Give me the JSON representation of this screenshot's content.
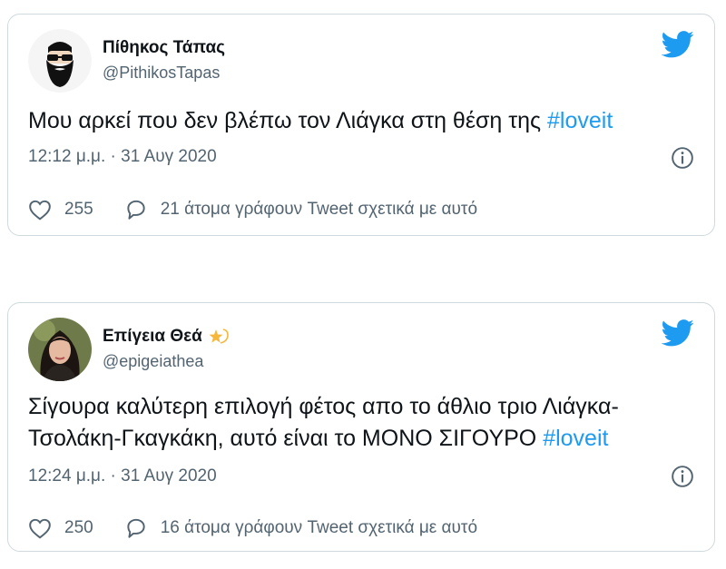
{
  "tweets": [
    {
      "display_name": "Πίθηκος Τάπας",
      "handle": "@PithikosTapas",
      "text": "Μου αρκεί που δεν βλέπω τον Λιάγκα στη θέση της ",
      "hashtag": "#loveit",
      "time": "12:12 μ.μ.",
      "separator": " · ",
      "date": "31 Αυγ 2020",
      "likes": "255",
      "replies": "21 άτομα γράφουν Tweet σχετικά με αυτό",
      "avatar": "bearded-man-sunglasses"
    },
    {
      "display_name": "Επίγεια Θεά",
      "name_emoji": "dizzy-star-icon",
      "handle": "@epigeiathea",
      "text": "Σίγουρα καλύτερη επιλογή φέτος απο το άθλιο τριο Λιάγκα-Τσολάκη-Γκαγκάκη, αυτό είναι το ΜΟΝΟ ΣΙΓΟΥΡΟ ",
      "hashtag": "#loveit",
      "time": "12:24 μ.μ.",
      "separator": " · ",
      "date": "31 Αυγ 2020",
      "likes": "250",
      "replies": "16 άτομα γράφουν Tweet σχετικά με αυτό",
      "avatar": "woman-photo"
    }
  ],
  "colors": {
    "accent": "#1d9bf0",
    "text": "#0f1419",
    "secondary": "#536471",
    "border": "#cfd9de"
  }
}
